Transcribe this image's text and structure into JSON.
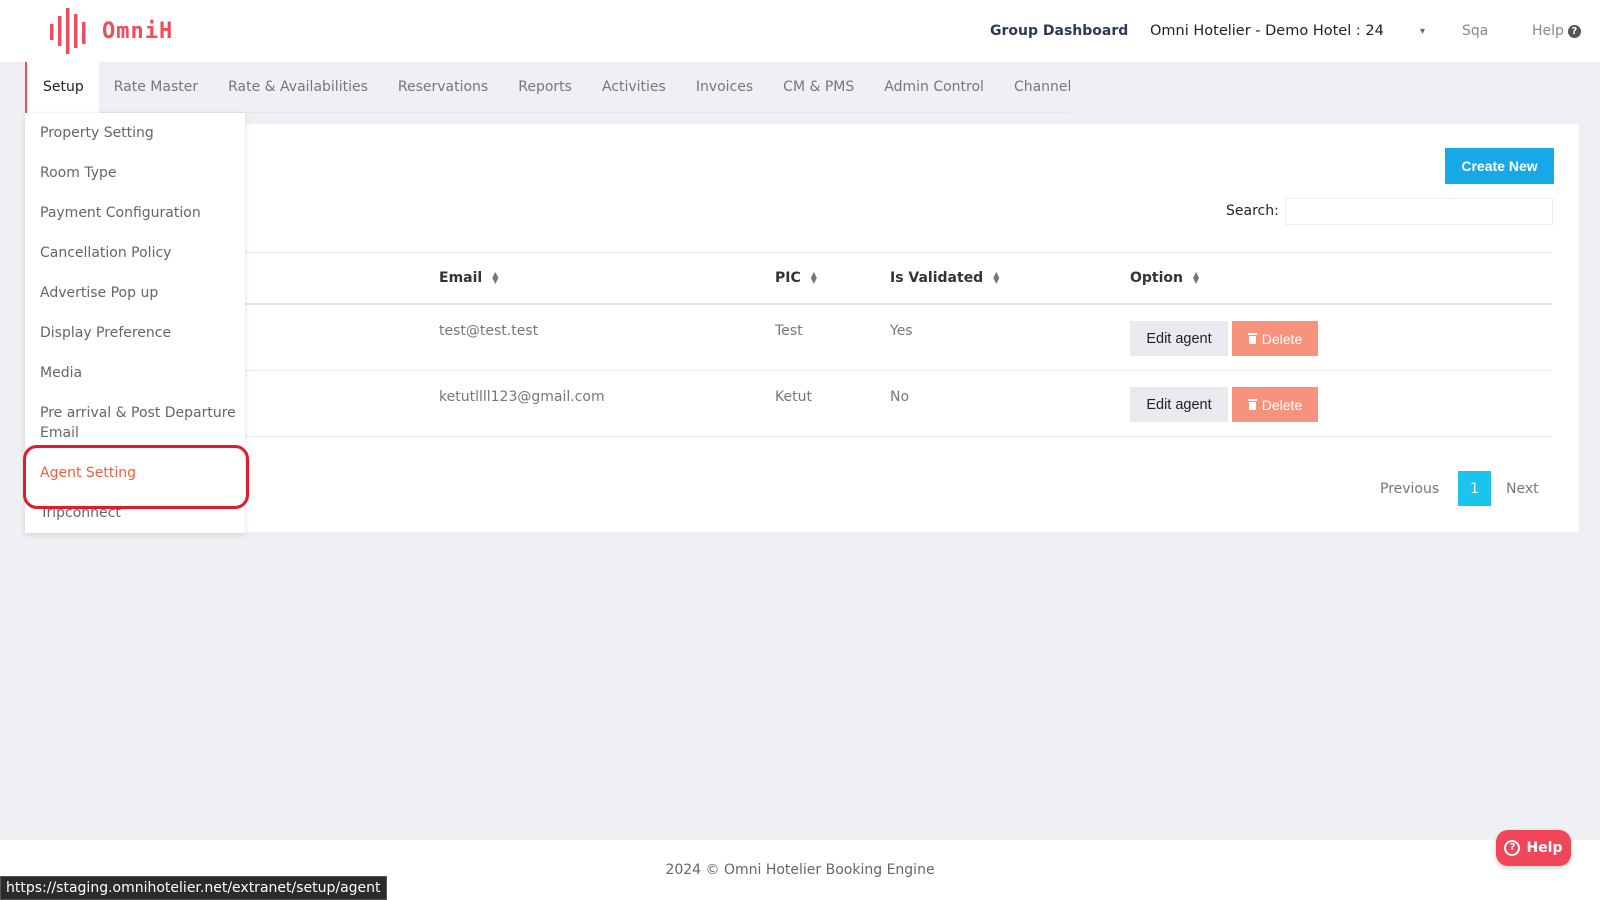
{
  "header": {
    "logo_text": "OmniH",
    "group_dashboard": "Group Dashboard",
    "hotel": "Omni Hotelier - Demo Hotel : 24",
    "caret": "▾",
    "user": "Sqa",
    "help": "Help",
    "help_icon": "?"
  },
  "nav": {
    "items": [
      "Setup",
      "Rate Master",
      "Rate & Availabilities",
      "Reservations",
      "Reports",
      "Activities",
      "Invoices",
      "CM & PMS",
      "Admin Control",
      "Channel"
    ]
  },
  "dropdown": {
    "items": [
      "Property Setting",
      "Room Type",
      "Payment Configuration",
      "Cancellation Policy",
      "Advertise Pop up",
      "Display Preference",
      "Media",
      "Pre arrival & Post Departure Email",
      "Agent Setting",
      "Tripconnect"
    ]
  },
  "content": {
    "create_label": "Create New",
    "search_label": "Search:",
    "search_value": "",
    "columns": [
      "Email",
      "PIC",
      "Is Validated",
      "Option"
    ],
    "rows": [
      {
        "email": "test@test.test",
        "pic": "Test",
        "validated": "Yes",
        "edit": "Edit agent",
        "delete": "Delete"
      },
      {
        "email": "ketutllll123@gmail.com",
        "pic": "Ketut",
        "validated": "No",
        "edit": "Edit agent",
        "delete": "Delete"
      }
    ],
    "pagination": {
      "previous": "Previous",
      "current": "1",
      "next": "Next"
    }
  },
  "footer": {
    "copyright": "2024 © Omni Hotelier Booking Engine",
    "status_url": "https://staging.omnihotelier.net/extranet/setup/agent",
    "help_float": "Help",
    "help_float_icon": "?"
  },
  "colors": {
    "brand": "#ee4d5f",
    "primary_button": "#17a8e8",
    "delete_button": "#f7937c",
    "active_menu": "#f2603a",
    "highlight_ring": "#e01b2b"
  }
}
